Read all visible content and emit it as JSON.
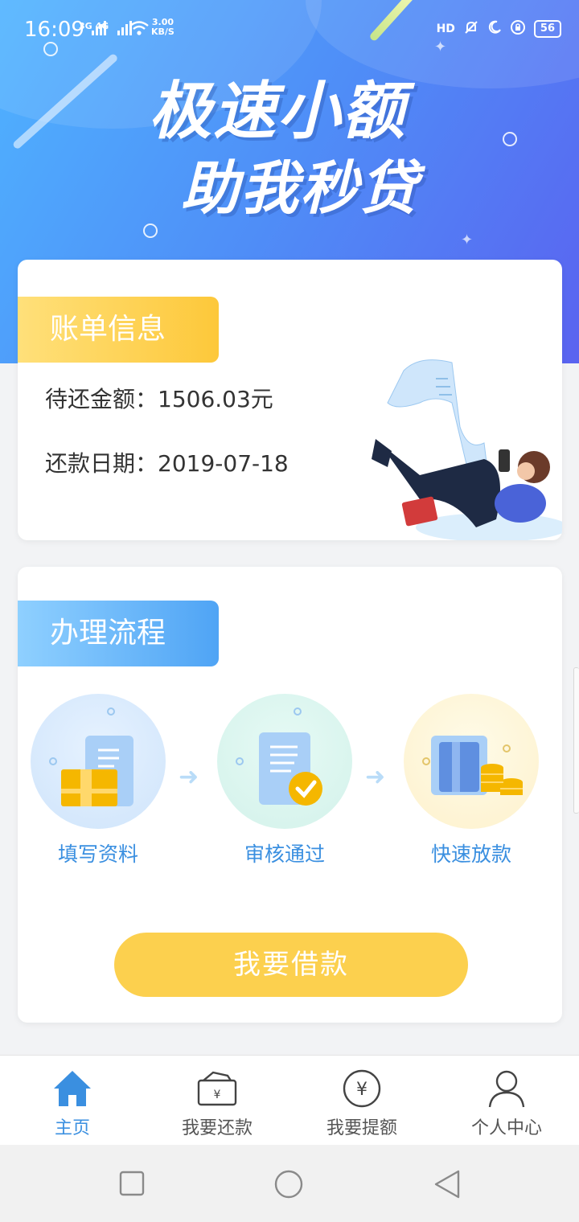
{
  "status_bar": {
    "time": "16:09",
    "network": "3G 4G",
    "speed_value": "3.00",
    "speed_unit": "KB/S",
    "hd_label": "HD",
    "battery": "56"
  },
  "hero": {
    "title": "极速小额",
    "subtitle": "助我秒贷"
  },
  "bill": {
    "tag": "账单信息",
    "amount_label": "待还金额：",
    "amount_value": "1506.03元",
    "date_label": "还款日期：",
    "date_value": "2019-07-18"
  },
  "process": {
    "tag": "办理流程",
    "steps": [
      {
        "label": "填写资料",
        "icon": "document-form-icon"
      },
      {
        "label": "审核通过",
        "icon": "approved-check-icon"
      },
      {
        "label": "快速放款",
        "icon": "card-coins-icon"
      }
    ],
    "button": "我要借款"
  },
  "tabbar": {
    "items": [
      {
        "label": "主页",
        "icon": "home-icon",
        "active": true
      },
      {
        "label": "我要还款",
        "icon": "wallet-yen-icon",
        "active": false
      },
      {
        "label": "我要提额",
        "icon": "yen-circle-icon",
        "active": false
      },
      {
        "label": "个人中心",
        "icon": "user-icon",
        "active": false
      }
    ]
  },
  "colors": {
    "accent_blue": "#3a8fe0",
    "button_yellow": "#fcd04e",
    "hero_blue": "#4f8df7"
  }
}
